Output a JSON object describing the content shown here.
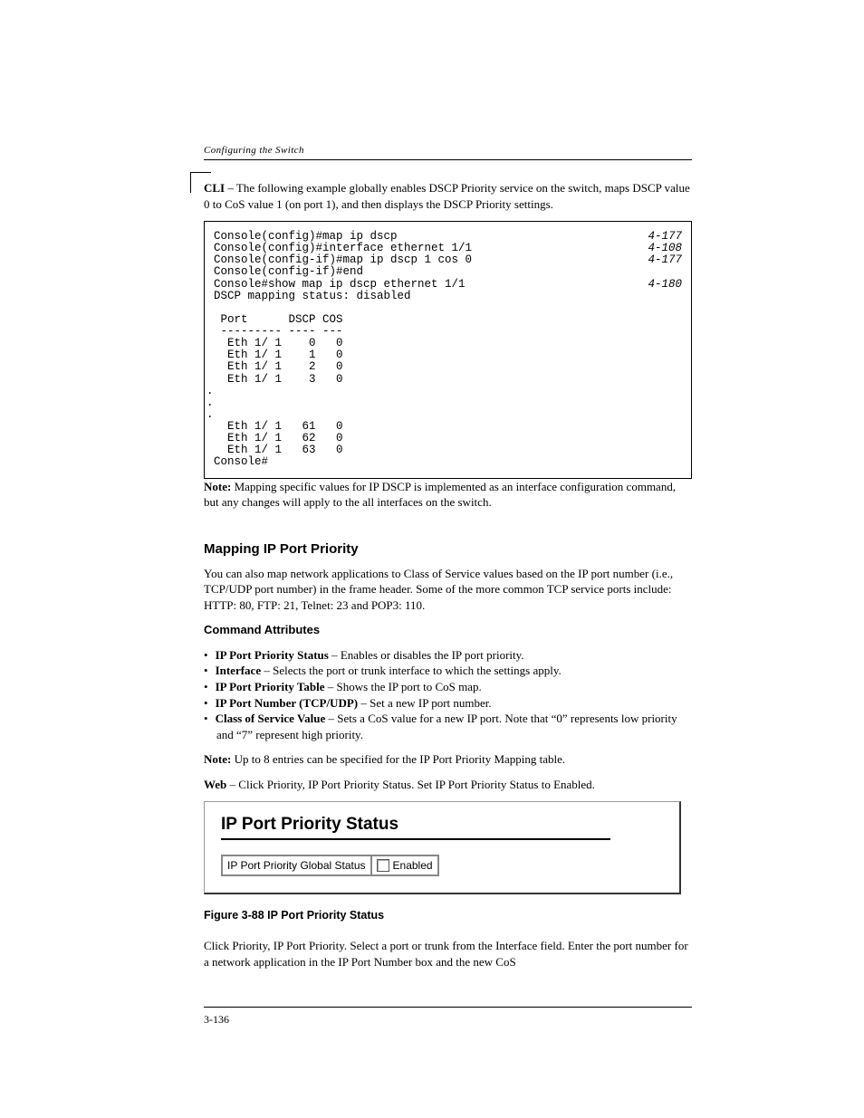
{
  "header": {
    "running_head": "Configuring the Switch",
    "page_number": "3-136"
  },
  "cli_intro": "CLI – The following example globally enables DSCP Priority service on the switch, maps DSCP value 0 to CoS value 1 (on port 1), and then displays the DSCP Priority settings.",
  "code": {
    "lines": [
      {
        "text": "Console(config)#map ip dscp",
        "ref": "4-177"
      },
      {
        "text": "Console(config)#interface ethernet 1/1",
        "ref": "4-108"
      },
      {
        "text": "Console(config-if)#map ip dscp 1 cos 0",
        "ref": "4-177"
      },
      {
        "text": "Console(config-if)#end",
        "ref": ""
      },
      {
        "text": "Console#show map ip dscp ethernet 1/1",
        "ref": "4-180"
      },
      {
        "text": "DSCP mapping status: disabled",
        "ref": ""
      },
      {
        "text": "",
        "ref": ""
      },
      {
        "text": " Port      DSCP COS",
        "ref": ""
      },
      {
        "text": " --------- ---- ---",
        "ref": ""
      },
      {
        "text": "  Eth 1/ 1    0   0",
        "ref": ""
      },
      {
        "text": "  Eth 1/ 1    1   0",
        "ref": ""
      },
      {
        "text": "  Eth 1/ 1    2   0",
        "ref": ""
      },
      {
        "text": "  Eth 1/ 1    3   0",
        "ref": ""
      }
    ],
    "ellipsis": ".\n.\n.",
    "lines2": [
      {
        "text": "  Eth 1/ 1   61   0",
        "ref": ""
      },
      {
        "text": "  Eth 1/ 1   62   0",
        "ref": ""
      },
      {
        "text": "  Eth 1/ 1   63   0",
        "ref": ""
      },
      {
        "text": "Console#",
        "ref": ""
      }
    ]
  },
  "note": {
    "label": "Note: ",
    "text": "Mapping specific values for IP DSCP is implemented as an interface configuration command, but any changes will apply to the all interfaces on the switch."
  },
  "section": {
    "title": "Mapping IP Port Priority",
    "p1": "You can also map network applications to Class of Service values based on the IP port number (i.e., TCP/UDP port number) in the frame header. Some of the more common TCP service ports include: HTTP: 80, FTP: 21, Telnet: 23 and POP3: 110.",
    "attr_label": "Command Attributes",
    "bullets": [
      {
        "b": "IP Port Priority Status",
        "t": " – Enables or disables the IP port priority."
      },
      {
        "b": "Interface",
        "t": " – Selects the port or trunk interface to which the settings apply."
      },
      {
        "b": "IP Port Priority Table",
        "t": " – Shows the IP port to CoS map."
      },
      {
        "b": "IP Port Number (TCP/UDP)",
        "t": " – Set a new IP port number."
      },
      {
        "b": "Class of Service Value",
        "t": " – Sets a CoS value for a new IP port. Note that “0” represents low priority and “7” represent high priority."
      }
    ],
    "note2_label": "Note: ",
    "note2_text": "Up to 8 entries can be specified for the IP Port Priority Mapping table.",
    "web1": " – Click Priority, IP Port Priority Status. Set IP Port Priority Status to Enabled.",
    "web_label": "Web"
  },
  "panel": {
    "title": "IP Port Priority Status",
    "row_label": "IP Port Priority Global Status",
    "checkbox_label": "Enabled",
    "checked": false
  },
  "figure": {
    "caption": "Figure 3-88   IP Port Priority Status"
  },
  "footer_text": "Click Priority, IP Port Priority. Select a port or trunk from the Interface field. Enter the port number for a network application in the IP Port Number box and the new CoS"
}
